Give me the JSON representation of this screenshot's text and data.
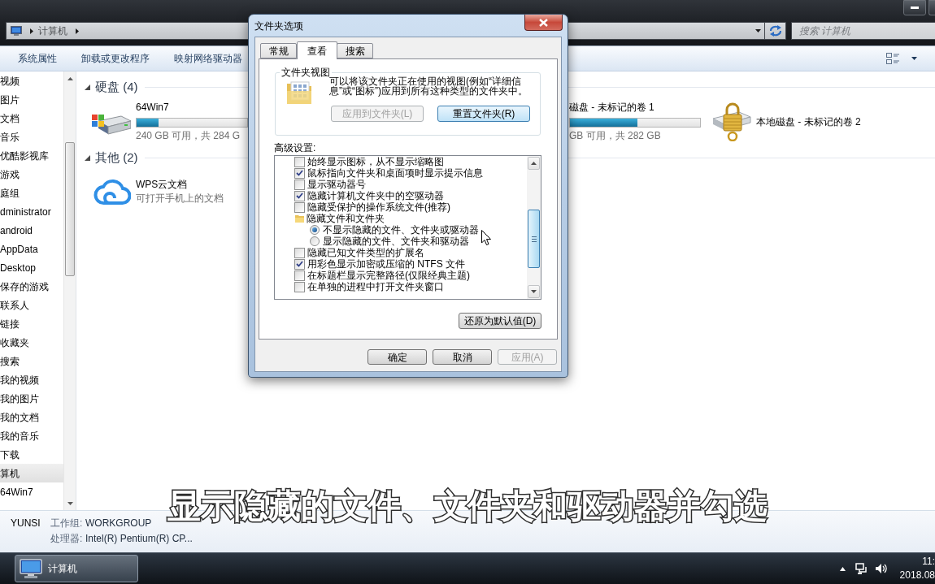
{
  "address_bar": {
    "breadcrumb": [
      "计算机"
    ]
  },
  "search": {
    "placeholder": "搜索 计算机"
  },
  "toolbar": {
    "items": [
      "系统属性",
      "卸载或更改程序",
      "映射网络驱动器"
    ]
  },
  "nav_pane": {
    "items": [
      {
        "label": "视频",
        "selected": false
      },
      {
        "label": "图片",
        "selected": false
      },
      {
        "label": "文档",
        "selected": false
      },
      {
        "label": "音乐",
        "selected": false
      },
      {
        "label": "优酷影视库",
        "selected": false
      },
      {
        "label": "游戏",
        "selected": false
      },
      {
        "label": "庭组",
        "selected": false
      },
      {
        "label": "dministrator",
        "selected": false
      },
      {
        "label": "android",
        "selected": false
      },
      {
        "label": "AppData",
        "selected": false
      },
      {
        "label": "Desktop",
        "selected": false
      },
      {
        "label": "保存的游戏",
        "selected": false
      },
      {
        "label": "联系人",
        "selected": false
      },
      {
        "label": "链接",
        "selected": false
      },
      {
        "label": "收藏夹",
        "selected": false
      },
      {
        "label": "搜索",
        "selected": false
      },
      {
        "label": "我的视频",
        "selected": false
      },
      {
        "label": "我的图片",
        "selected": false
      },
      {
        "label": "我的文档",
        "selected": false
      },
      {
        "label": "我的音乐",
        "selected": false
      },
      {
        "label": "下载",
        "selected": false
      },
      {
        "label": "算机",
        "selected": true
      },
      {
        "label": "64Win7",
        "selected": false
      }
    ]
  },
  "content": {
    "groups": [
      {
        "title": "硬盘 (4)",
        "expanded": true,
        "items": [
          {
            "kind": "drive",
            "name": "64Win7",
            "level": 0.2,
            "free_space": "240 GB 可用，共 284 G"
          },
          {
            "kind": "drive_partial",
            "name": "磁盘 - 未标记的卷 1",
            "level": 0.52,
            "free_space": "GB 可用，共 282 GB"
          },
          {
            "kind": "locked_drive",
            "name": "本地磁盘 - 未标记的卷 2"
          }
        ]
      },
      {
        "title": "其他 (2)",
        "expanded": true,
        "items": [
          {
            "kind": "cloud",
            "name": "WPS云文档",
            "description": "可打开手机上的文档"
          }
        ]
      }
    ]
  },
  "details_pane": {
    "name": "YUNSI",
    "fields": [
      {
        "label": "工作组:",
        "value": "WORKGROUP"
      },
      {
        "label": "处理器:",
        "value": "Intel(R) Pentium(R) CP..."
      }
    ]
  },
  "dialog": {
    "title": "文件夹选项",
    "tabs": [
      {
        "label": "常规",
        "selected": false
      },
      {
        "label": "查看",
        "selected": true
      },
      {
        "label": "搜索",
        "selected": false
      }
    ],
    "folder_views": {
      "title": "文件夹视图",
      "description": "可以将该文件夹正在使用的视图(例如“详细信息”或“图标”)应用到所有这种类型的文件夹中。",
      "buttons": [
        {
          "label": "应用到文件夹(L)",
          "disabled": true,
          "focused": false
        },
        {
          "label": "重置文件夹(R)",
          "disabled": false,
          "focused": true
        }
      ]
    },
    "advanced": {
      "label": "高级设置:",
      "items": [
        {
          "kind": "checkbox",
          "label": "始终显示图标，从不显示缩略图",
          "checked": false
        },
        {
          "kind": "checkbox",
          "label": "鼠标指向文件夹和桌面项时显示提示信息",
          "checked": true
        },
        {
          "kind": "checkbox",
          "label": "显示驱动器号",
          "checked": false
        },
        {
          "kind": "checkbox",
          "label": "隐藏计算机文件夹中的空驱动器",
          "checked": true
        },
        {
          "kind": "checkbox",
          "label": "隐藏受保护的操作系统文件(推荐)",
          "checked": false
        },
        {
          "kind": "folder",
          "label": "隐藏文件和文件夹",
          "children": [
            {
              "kind": "radio",
              "label": "不显示隐藏的文件、文件夹或驱动器",
              "selected": true
            },
            {
              "kind": "radio",
              "label": "显示隐藏的文件、文件夹和驱动器",
              "selected": false
            }
          ]
        },
        {
          "kind": "checkbox",
          "label": "隐藏已知文件类型的扩展名",
          "checked": false
        },
        {
          "kind": "checkbox",
          "label": "用彩色显示加密或压缩的 NTFS 文件",
          "checked": true
        },
        {
          "kind": "checkbox",
          "label": "在标题栏显示完整路径(仅限经典主题)",
          "checked": false
        },
        {
          "kind": "checkbox",
          "label": "在单独的进程中打开文件夹窗口",
          "checked": false
        }
      ]
    },
    "restore_button": "还原为默认值(D)",
    "buttons": [
      {
        "label": "确定",
        "disabled": false
      },
      {
        "label": "取消",
        "disabled": false
      },
      {
        "label": "应用(A)",
        "disabled": true
      }
    ]
  },
  "subtitle": "显示隐藏的文件、文件夹和驱动器并勾选",
  "taskbar": {
    "items": [
      {
        "label": "计算机"
      }
    ],
    "clock": {
      "time": "11:",
      "date": "2018.08"
    }
  }
}
